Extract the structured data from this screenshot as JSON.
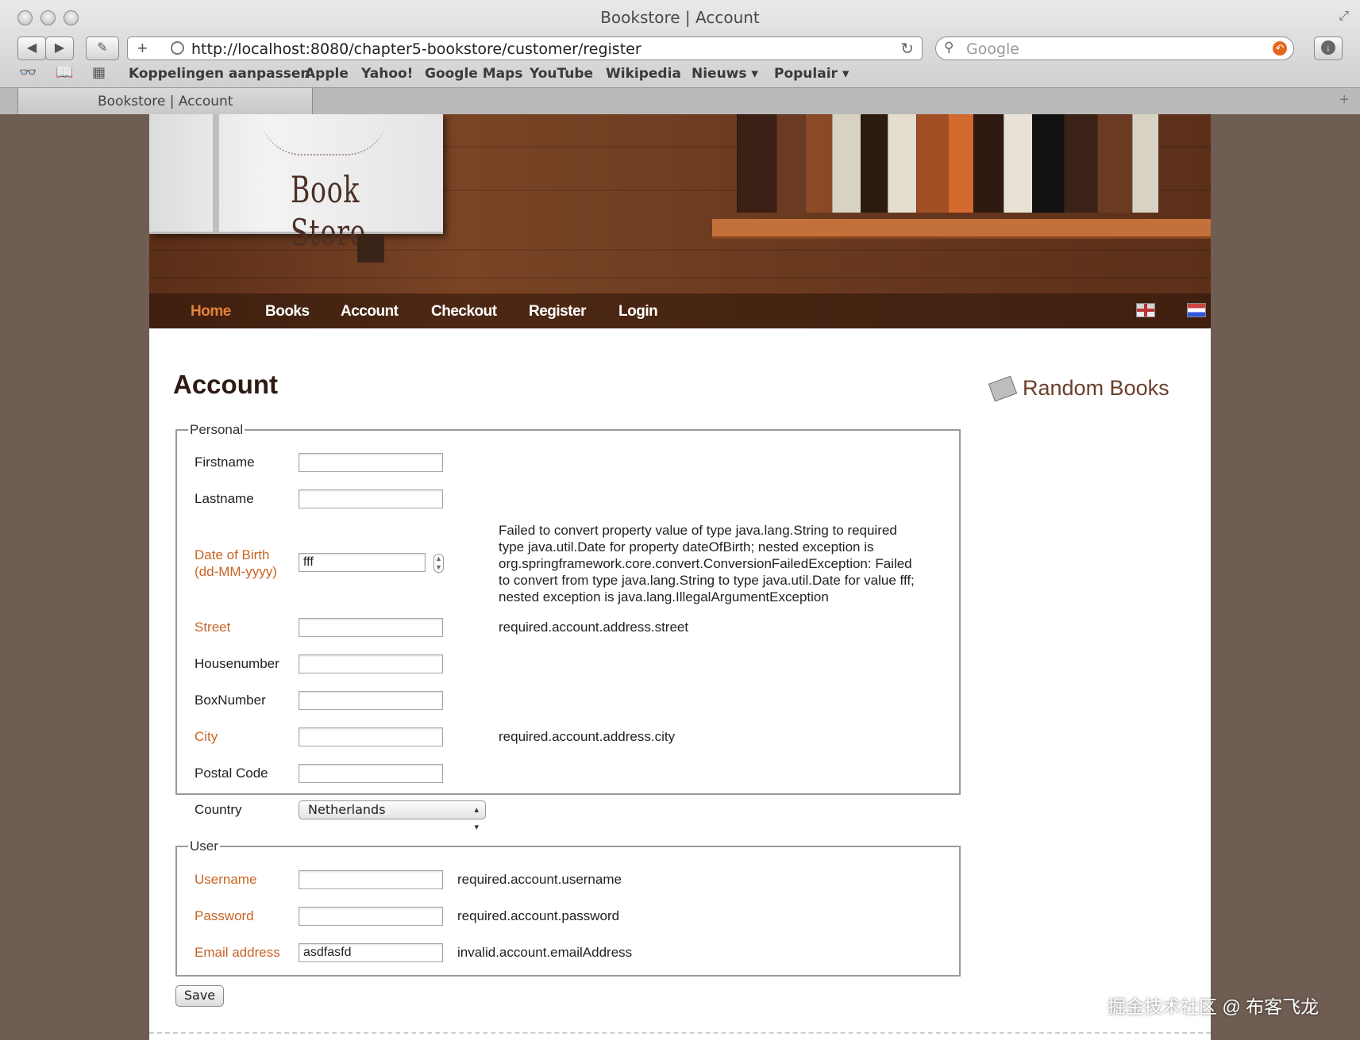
{
  "browser": {
    "window_title": "Bookstore | Account",
    "url": "http://localhost:8080/chapter5-bookstore/customer/register",
    "search_placeholder": "Google",
    "bookmarks": [
      "Koppelingen aanpassen",
      "Apple",
      "Yahoo!",
      "Google Maps",
      "YouTube",
      "Wikipedia",
      "Nieuws ▾",
      "Populair ▾"
    ],
    "tab_title": "Bookstore | Account"
  },
  "header": {
    "logo": "Book Store",
    "nav": [
      "Home",
      "Books",
      "Account",
      "Checkout",
      "Register",
      "Login"
    ],
    "active_nav": "Home"
  },
  "main": {
    "title": "Account",
    "sidebar_title": "Random Books"
  },
  "personal": {
    "legend": "Personal",
    "firstname_label": "Firstname",
    "firstname_value": "",
    "lastname_label": "Lastname",
    "lastname_value": "",
    "dob_label_1": "Date of Birth",
    "dob_label_2": "(dd-MM-yyyy)",
    "dob_value": "fff",
    "dob_error": [
      "Failed to convert property value of type java.lang.String to required",
      "type java.util.Date for property dateOfBirth; nested exception is",
      "org.springframework.core.convert.ConversionFailedException: Failed",
      "to convert from type java.lang.String to type java.util.Date for value fff;",
      "nested exception is java.lang.IllegalArgumentException"
    ],
    "street_label": "Street",
    "street_value": "",
    "street_error": "required.account.address.street",
    "housenumber_label": "Housenumber",
    "housenumber_value": "",
    "boxnumber_label": "BoxNumber",
    "boxnumber_value": "",
    "city_label": "City",
    "city_value": "",
    "city_error": "required.account.address.city",
    "postal_label": "Postal Code",
    "postal_value": "",
    "country_label": "Country",
    "country_value": "Netherlands"
  },
  "user": {
    "legend": "User",
    "username_label": "Username",
    "username_value": "",
    "username_error": "required.account.username",
    "password_label": "Password",
    "password_value": "",
    "password_error": "required.account.password",
    "email_label": "Email address",
    "email_value": "asdfasfd",
    "email_error": "invalid.account.emailAddress"
  },
  "actions": {
    "save_label": "Save"
  },
  "watermark": "掘金技术社区 @ 布客飞龙",
  "colors": {
    "error_label": "#c86424",
    "nav_active": "#e5823a",
    "accent_title": "#6b3f2a"
  }
}
